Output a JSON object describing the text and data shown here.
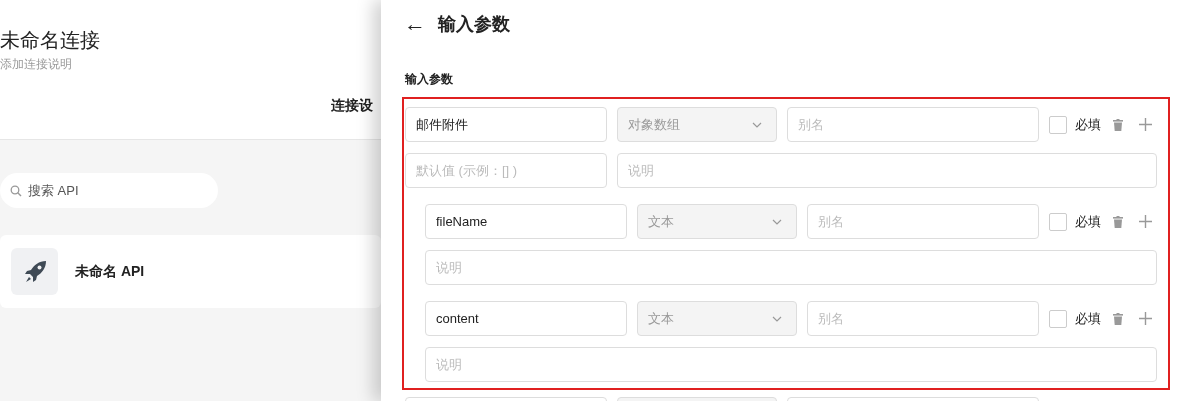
{
  "connection": {
    "title": "未命名连接",
    "description": "添加连接说明",
    "tab": "连接设",
    "search": {
      "placeholder": "搜索 API"
    },
    "apis": [
      {
        "name": "未命名 API"
      }
    ]
  },
  "drawer": {
    "back": "←",
    "title": "输入参数",
    "section_label": "输入参数",
    "params": [
      {
        "name": "邮件附件",
        "type": "对象数组",
        "alias_placeholder": "别名",
        "required_label": "必填",
        "required": false,
        "default_placeholder": "默认值 (示例：[] )",
        "description_placeholder": "说明",
        "children": [
          {
            "name": "fileName",
            "type": "文本",
            "alias_placeholder": "别名",
            "required_label": "必填",
            "required": false,
            "description_placeholder": "说明"
          },
          {
            "name": "content",
            "type": "文本",
            "alias_placeholder": "别名",
            "required_label": "必填",
            "required": false,
            "description_placeholder": "说明"
          }
        ]
      }
    ]
  }
}
